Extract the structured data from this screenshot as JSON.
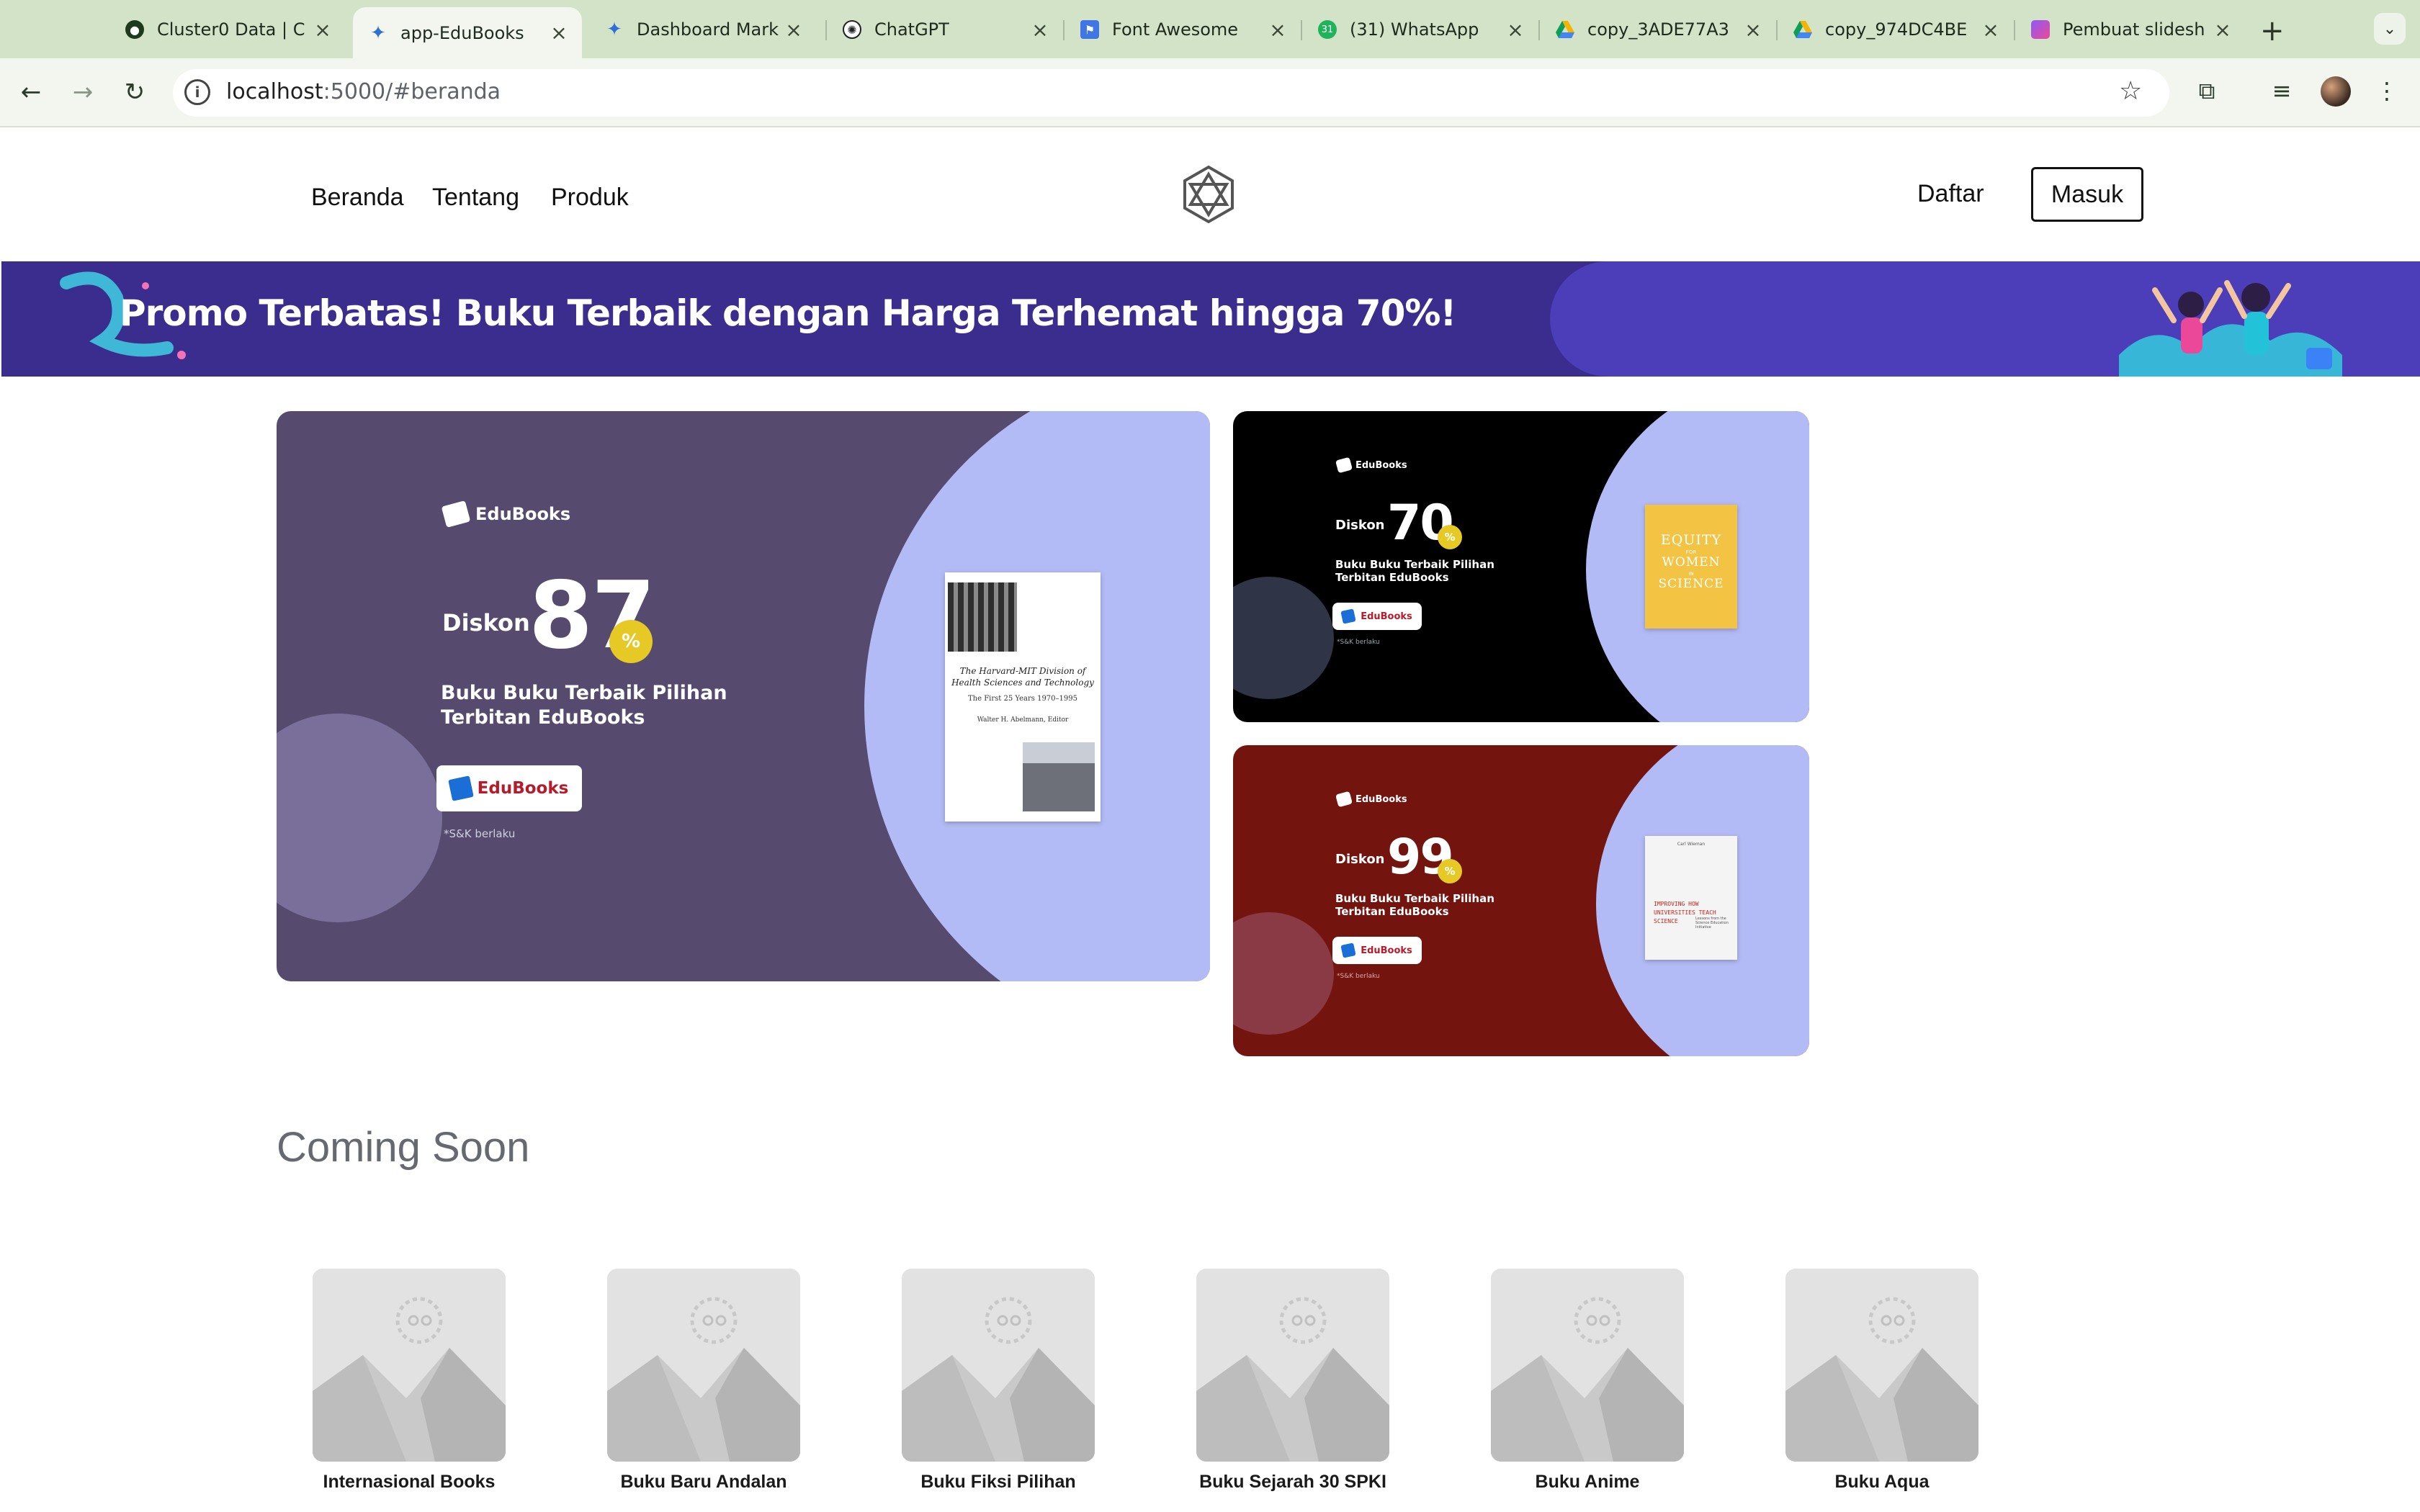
{
  "browser": {
    "tabs": [
      {
        "title": "Cluster0 Data | C",
        "fav": "mongodb-leaf-icon",
        "color": "#1e3a1c",
        "active": false
      },
      {
        "title": "app-EduBooks",
        "fav": "globe-icon",
        "color": "#2f6fd6",
        "active": true
      },
      {
        "title": "Dashboard Mark",
        "fav": "globe-icon",
        "color": "#2f6fd6",
        "active": false
      },
      {
        "title": "ChatGPT",
        "fav": "openai-icon",
        "color": "#222222",
        "active": false
      },
      {
        "title": "Font Awesome",
        "fav": "flag-icon",
        "color": "#3f76e4",
        "active": false
      },
      {
        "title": "(31) WhatsApp",
        "fav": "whatsapp-icon",
        "color": "#21b35c",
        "active": false
      },
      {
        "title": "copy_3ADE77A3",
        "fav": "google-drive-icon",
        "color": "#f4b400",
        "active": false
      },
      {
        "title": "copy_974DC4BE",
        "fav": "google-drive-icon",
        "color": "#f4b400",
        "active": false
      },
      {
        "title": "Pembuat slidesh",
        "fav": "slides-icon",
        "color": "#8b5cf6",
        "active": false
      }
    ],
    "url_host": "localhost",
    "url_rest": ":5000/#beranda"
  },
  "header": {
    "nav": [
      "Beranda",
      "Tentang",
      "Produk"
    ],
    "register": "Daftar",
    "login": "Masuk"
  },
  "promo_banner": {
    "text": "Promo Terbatas! Buku Terbaik dengan Harga Terhemat hingga 70%!"
  },
  "cards": [
    {
      "brand": "EduBooks",
      "diskon": "Diskon",
      "number": "87",
      "pct": "%",
      "tagline_1": "Buku Buku Terbaik Pilihan",
      "tagline_2": "Terbitan EduBooks",
      "pill": "EduBooks",
      "sk": "*S&K berlaku",
      "bg": "#564a6e",
      "cover": {
        "title_1": "The Harvard-MIT Division of",
        "title_2": "Health Sciences and Technology",
        "sub": "The First 25 Years 1970–1995",
        "author": "Walter H. Abelmann, Editor"
      }
    },
    {
      "brand": "EduBooks",
      "diskon": "Diskon",
      "number": "70",
      "pct": "%",
      "tagline_1": "Buku Buku Terbaik Pilihan",
      "tagline_2": "Terbitan EduBooks",
      "pill": "EduBooks",
      "sk": "*S&K berlaku",
      "bg": "#000000",
      "cover": {
        "line_1": "EQUITY",
        "line_2": "FOR",
        "line_3": "WOMEN",
        "line_4": "IN",
        "line_5": "SCIENCE"
      }
    },
    {
      "brand": "EduBooks",
      "diskon": "Diskon",
      "number": "99",
      "pct": "%",
      "tagline_1": "Buku Buku Terbaik Pilihan",
      "tagline_2": "Terbitan EduBooks",
      "pill": "EduBooks",
      "sk": "*S&K berlaku",
      "bg": "#74140f",
      "cover": {
        "author": "Carl Wieman",
        "line_1": "IMPROVING HOW",
        "line_2": "UNIVERSITIES TEACH",
        "line_3": "SCIENCE",
        "sub": "Lessons from the Science Education Initiative"
      }
    }
  ],
  "coming_soon": {
    "title": "Coming Soon",
    "items": [
      "Internasional Books",
      "Buku Baru Andalan",
      "Buku Fiksi Pilihan",
      "Buku Sejarah 30 SPKI",
      "Buku Anime",
      "Buku Aqua"
    ]
  }
}
